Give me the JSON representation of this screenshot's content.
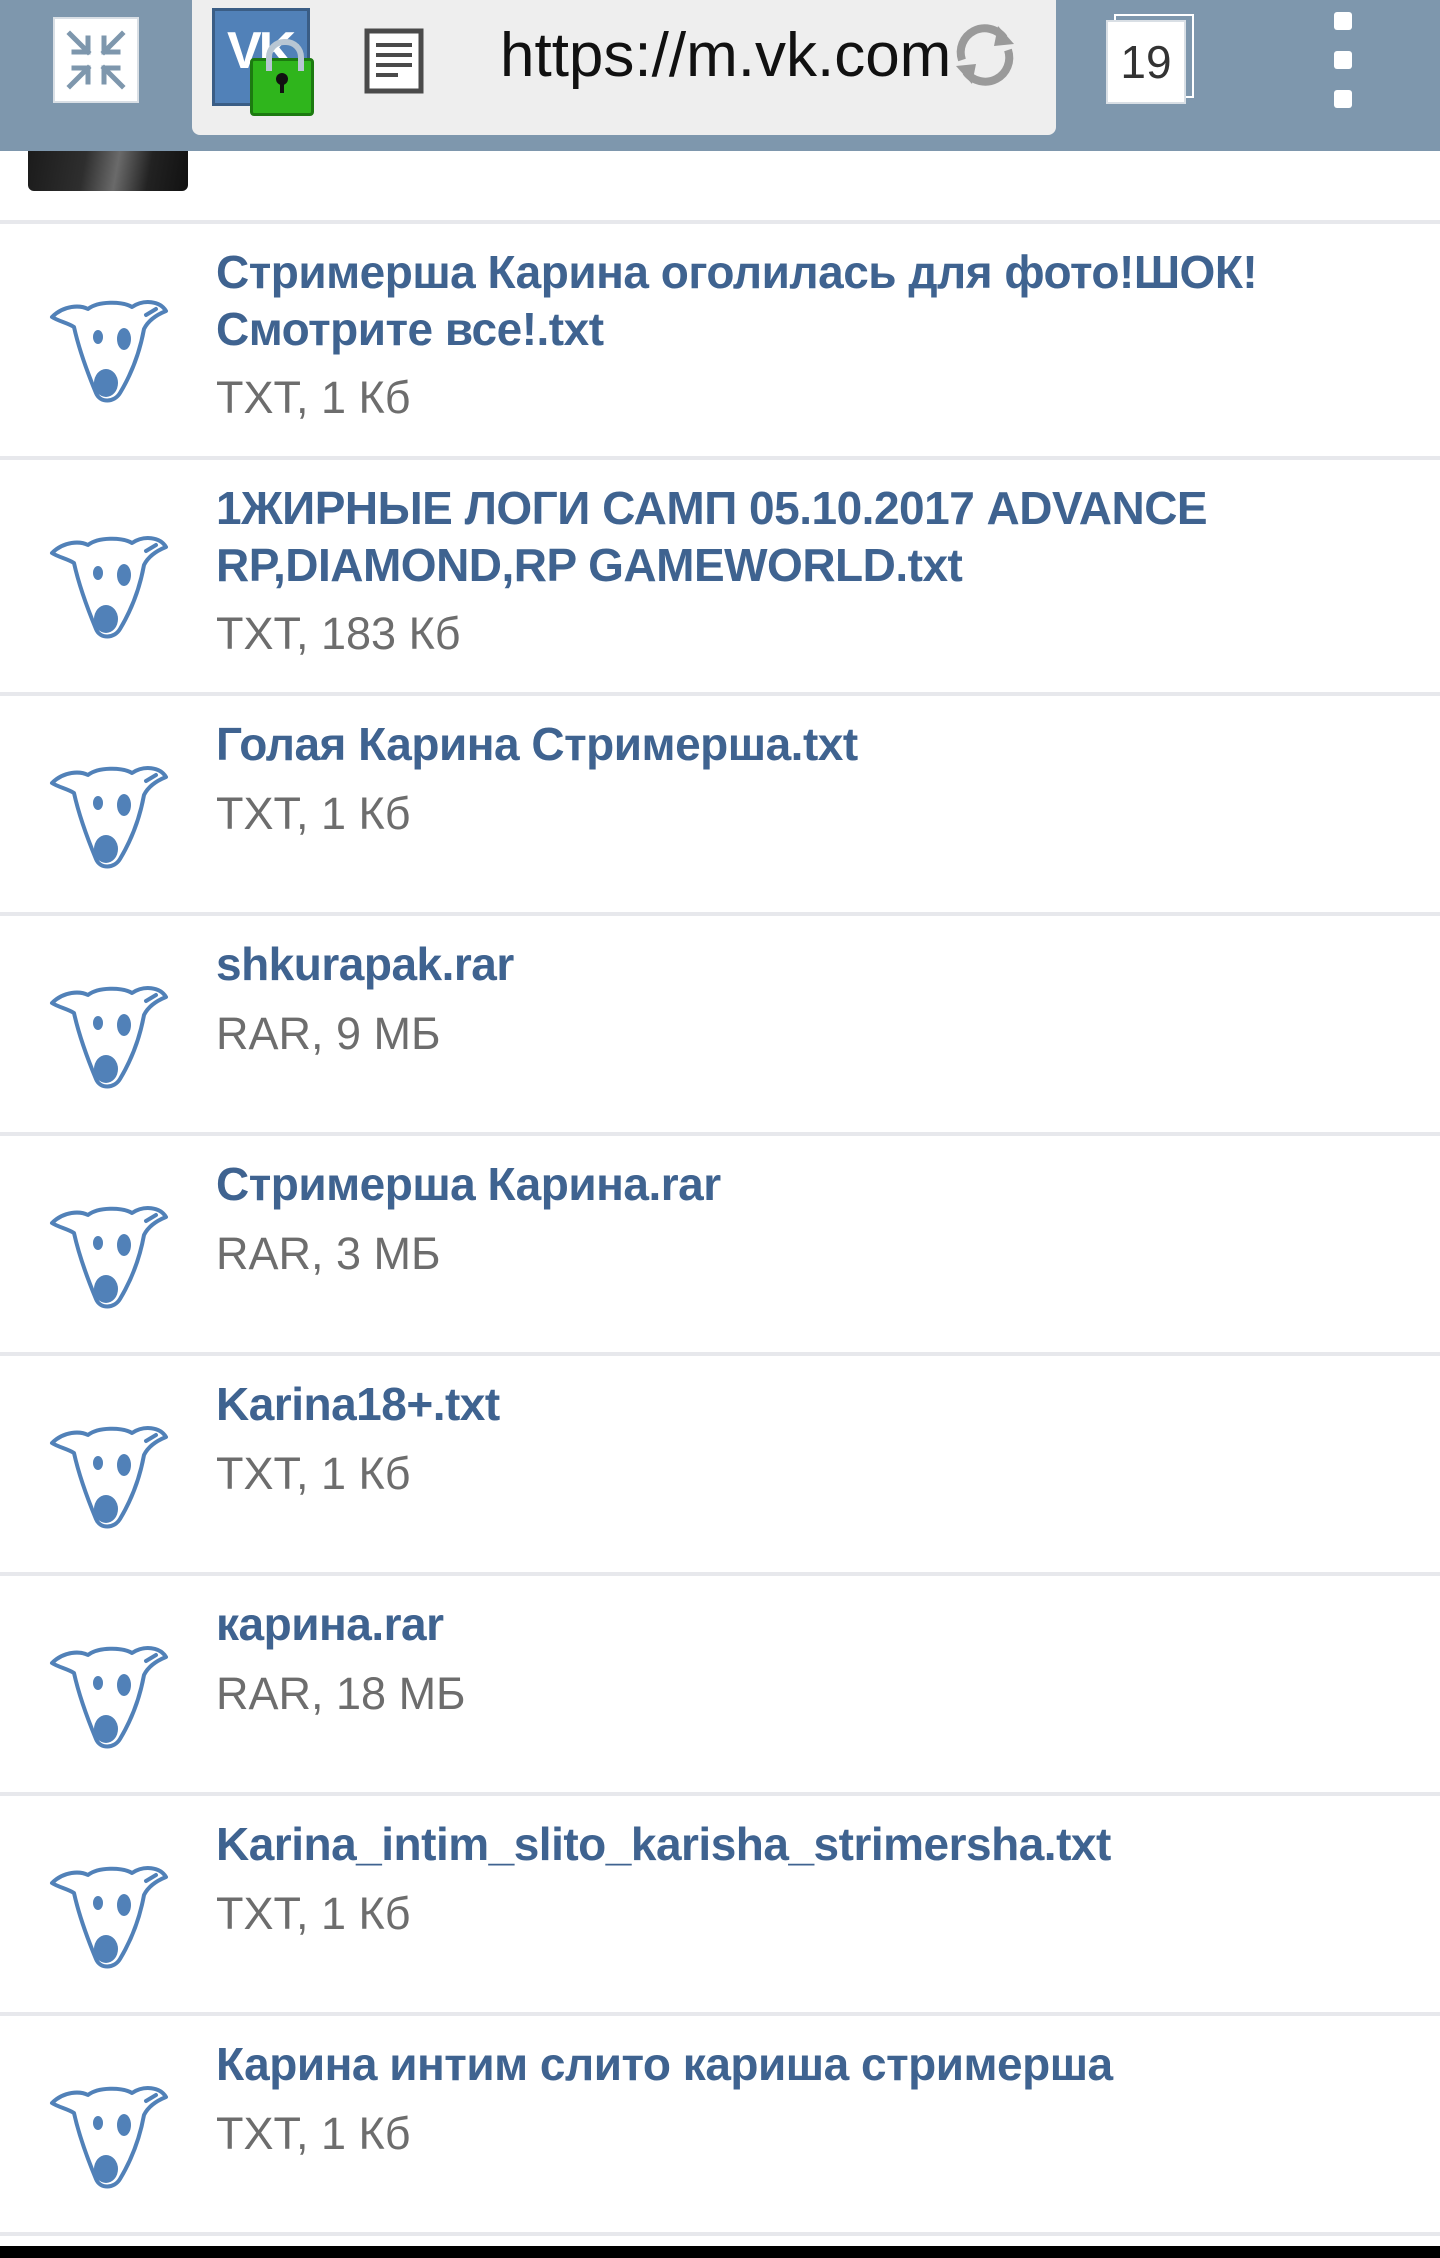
{
  "browser": {
    "url": "https://m.vk.com",
    "tab_count": "19",
    "favicon_text": "VK",
    "colors": {
      "toolbar": "#7e97ad",
      "urlbar": "#eeeeee",
      "lock": "#2fb51c"
    }
  },
  "documents": [
    {
      "title": "Стримерша Карина оголилась для фото!ШОК! Смотрите все!.txt",
      "meta": "TXT, 1 Кб"
    },
    {
      "title": "1ЖИРНЫЕ ЛОГИ САМП 05.10.2017 ADVANCE RP,DIAMOND,RP GAMEWORLD.txt",
      "meta": "TXT, 183 Кб"
    },
    {
      "title": "Голая Карина Стримерша.txt",
      "meta": "TXT, 1 Кб"
    },
    {
      "title": "shkurapak.rar",
      "meta": "RAR, 9 МБ"
    },
    {
      "title": "Стримерша Карина.rar",
      "meta": "RAR, 3 МБ"
    },
    {
      "title": "Karina18+.txt",
      "meta": "TXT, 1 Кб"
    },
    {
      "title": "карина.rar",
      "meta": "RAR, 18 МБ"
    },
    {
      "title": "Karina_intim_slito_karisha_strimersha.txt",
      "meta": "TXT, 1 Кб"
    },
    {
      "title": "Карина интим слито кариша стримерша",
      "meta": "TXT, 1 Кб"
    }
  ],
  "colors": {
    "link": "#3f6390",
    "meta": "#6d6d6d",
    "divider": "#e7e8ec",
    "doc_icon": "#5181b8"
  }
}
